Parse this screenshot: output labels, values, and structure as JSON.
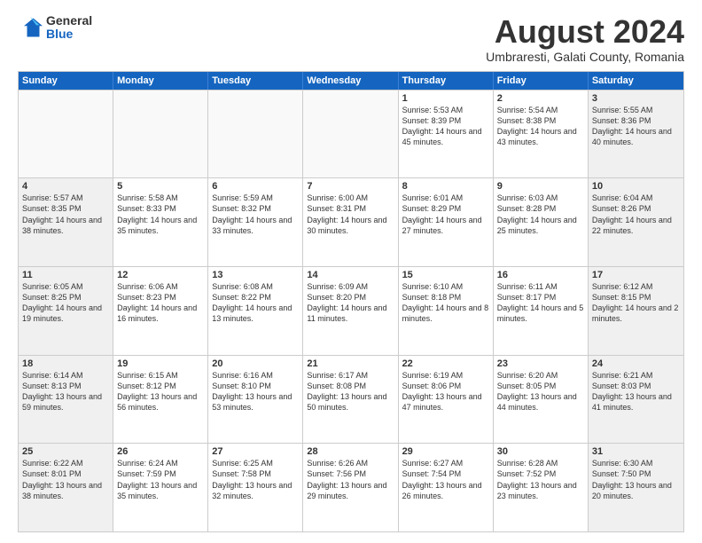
{
  "logo": {
    "general": "General",
    "blue": "Blue"
  },
  "title": "August 2024",
  "subtitle": "Umbraresti, Galati County, Romania",
  "header_days": [
    "Sunday",
    "Monday",
    "Tuesday",
    "Wednesday",
    "Thursday",
    "Friday",
    "Saturday"
  ],
  "weeks": [
    [
      {
        "day": "",
        "text": ""
      },
      {
        "day": "",
        "text": ""
      },
      {
        "day": "",
        "text": ""
      },
      {
        "day": "",
        "text": ""
      },
      {
        "day": "1",
        "text": "Sunrise: 5:53 AM\nSunset: 8:39 PM\nDaylight: 14 hours and 45 minutes."
      },
      {
        "day": "2",
        "text": "Sunrise: 5:54 AM\nSunset: 8:38 PM\nDaylight: 14 hours and 43 minutes."
      },
      {
        "day": "3",
        "text": "Sunrise: 5:55 AM\nSunset: 8:36 PM\nDaylight: 14 hours and 40 minutes."
      }
    ],
    [
      {
        "day": "4",
        "text": "Sunrise: 5:57 AM\nSunset: 8:35 PM\nDaylight: 14 hours and 38 minutes."
      },
      {
        "day": "5",
        "text": "Sunrise: 5:58 AM\nSunset: 8:33 PM\nDaylight: 14 hours and 35 minutes."
      },
      {
        "day": "6",
        "text": "Sunrise: 5:59 AM\nSunset: 8:32 PM\nDaylight: 14 hours and 33 minutes."
      },
      {
        "day": "7",
        "text": "Sunrise: 6:00 AM\nSunset: 8:31 PM\nDaylight: 14 hours and 30 minutes."
      },
      {
        "day": "8",
        "text": "Sunrise: 6:01 AM\nSunset: 8:29 PM\nDaylight: 14 hours and 27 minutes."
      },
      {
        "day": "9",
        "text": "Sunrise: 6:03 AM\nSunset: 8:28 PM\nDaylight: 14 hours and 25 minutes."
      },
      {
        "day": "10",
        "text": "Sunrise: 6:04 AM\nSunset: 8:26 PM\nDaylight: 14 hours and 22 minutes."
      }
    ],
    [
      {
        "day": "11",
        "text": "Sunrise: 6:05 AM\nSunset: 8:25 PM\nDaylight: 14 hours and 19 minutes."
      },
      {
        "day": "12",
        "text": "Sunrise: 6:06 AM\nSunset: 8:23 PM\nDaylight: 14 hours and 16 minutes."
      },
      {
        "day": "13",
        "text": "Sunrise: 6:08 AM\nSunset: 8:22 PM\nDaylight: 14 hours and 13 minutes."
      },
      {
        "day": "14",
        "text": "Sunrise: 6:09 AM\nSunset: 8:20 PM\nDaylight: 14 hours and 11 minutes."
      },
      {
        "day": "15",
        "text": "Sunrise: 6:10 AM\nSunset: 8:18 PM\nDaylight: 14 hours and 8 minutes."
      },
      {
        "day": "16",
        "text": "Sunrise: 6:11 AM\nSunset: 8:17 PM\nDaylight: 14 hours and 5 minutes."
      },
      {
        "day": "17",
        "text": "Sunrise: 6:12 AM\nSunset: 8:15 PM\nDaylight: 14 hours and 2 minutes."
      }
    ],
    [
      {
        "day": "18",
        "text": "Sunrise: 6:14 AM\nSunset: 8:13 PM\nDaylight: 13 hours and 59 minutes."
      },
      {
        "day": "19",
        "text": "Sunrise: 6:15 AM\nSunset: 8:12 PM\nDaylight: 13 hours and 56 minutes."
      },
      {
        "day": "20",
        "text": "Sunrise: 6:16 AM\nSunset: 8:10 PM\nDaylight: 13 hours and 53 minutes."
      },
      {
        "day": "21",
        "text": "Sunrise: 6:17 AM\nSunset: 8:08 PM\nDaylight: 13 hours and 50 minutes."
      },
      {
        "day": "22",
        "text": "Sunrise: 6:19 AM\nSunset: 8:06 PM\nDaylight: 13 hours and 47 minutes."
      },
      {
        "day": "23",
        "text": "Sunrise: 6:20 AM\nSunset: 8:05 PM\nDaylight: 13 hours and 44 minutes."
      },
      {
        "day": "24",
        "text": "Sunrise: 6:21 AM\nSunset: 8:03 PM\nDaylight: 13 hours and 41 minutes."
      }
    ],
    [
      {
        "day": "25",
        "text": "Sunrise: 6:22 AM\nSunset: 8:01 PM\nDaylight: 13 hours and 38 minutes."
      },
      {
        "day": "26",
        "text": "Sunrise: 6:24 AM\nSunset: 7:59 PM\nDaylight: 13 hours and 35 minutes."
      },
      {
        "day": "27",
        "text": "Sunrise: 6:25 AM\nSunset: 7:58 PM\nDaylight: 13 hours and 32 minutes."
      },
      {
        "day": "28",
        "text": "Sunrise: 6:26 AM\nSunset: 7:56 PM\nDaylight: 13 hours and 29 minutes."
      },
      {
        "day": "29",
        "text": "Sunrise: 6:27 AM\nSunset: 7:54 PM\nDaylight: 13 hours and 26 minutes."
      },
      {
        "day": "30",
        "text": "Sunrise: 6:28 AM\nSunset: 7:52 PM\nDaylight: 13 hours and 23 minutes."
      },
      {
        "day": "31",
        "text": "Sunrise: 6:30 AM\nSunset: 7:50 PM\nDaylight: 13 hours and 20 minutes."
      }
    ]
  ]
}
